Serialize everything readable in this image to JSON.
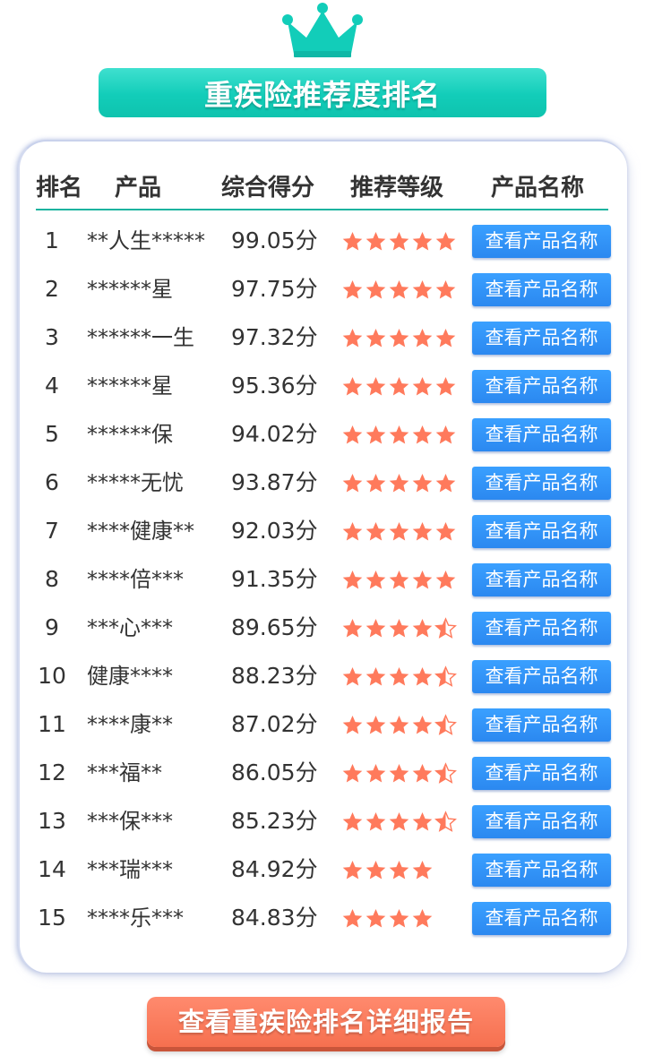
{
  "title": "重疾险推荐度排名",
  "table": {
    "headers": {
      "rank": "排名",
      "product": "产品",
      "score": "综合得分",
      "level": "推荐等级",
      "name": "产品名称"
    },
    "button_label": "查看产品名称",
    "star_color": "#ff7a5c",
    "rows": [
      {
        "rank": "1",
        "product": "**人生*****",
        "score": "99.05分",
        "stars": 5
      },
      {
        "rank": "2",
        "product": "******星",
        "score": "97.75分",
        "stars": 5
      },
      {
        "rank": "3",
        "product": "******一生",
        "score": "97.32分",
        "stars": 5
      },
      {
        "rank": "4",
        "product": "******星",
        "score": "95.36分",
        "stars": 5
      },
      {
        "rank": "5",
        "product": "******保",
        "score": "94.02分",
        "stars": 5
      },
      {
        "rank": "6",
        "product": "*****无忧",
        "score": "93.87分",
        "stars": 5
      },
      {
        "rank": "7",
        "product": "****健康**",
        "score": "92.03分",
        "stars": 5
      },
      {
        "rank": "8",
        "product": "****倍***",
        "score": "91.35分",
        "stars": 5
      },
      {
        "rank": "9",
        "product": "***心***",
        "score": "89.65分",
        "stars": 4.5
      },
      {
        "rank": "10",
        "product": "健康****",
        "score": "88.23分",
        "stars": 4.5
      },
      {
        "rank": "11",
        "product": "****康**",
        "score": "87.02分",
        "stars": 4.5
      },
      {
        "rank": "12",
        "product": "***福**",
        "score": "86.05分",
        "stars": 4.5
      },
      {
        "rank": "13",
        "product": "***保***",
        "score": "85.23分",
        "stars": 4.5
      },
      {
        "rank": "14",
        "product": "***瑞***",
        "score": "84.92分",
        "stars": 4
      },
      {
        "rank": "15",
        "product": "****乐***",
        "score": "84.83分",
        "stars": 4
      }
    ]
  },
  "cta_label": "查看重疾险排名详细报告",
  "colors": {
    "teal": "#12cdb9",
    "button_blue": "#2b88f0",
    "cta_orange": "#f6704f"
  }
}
